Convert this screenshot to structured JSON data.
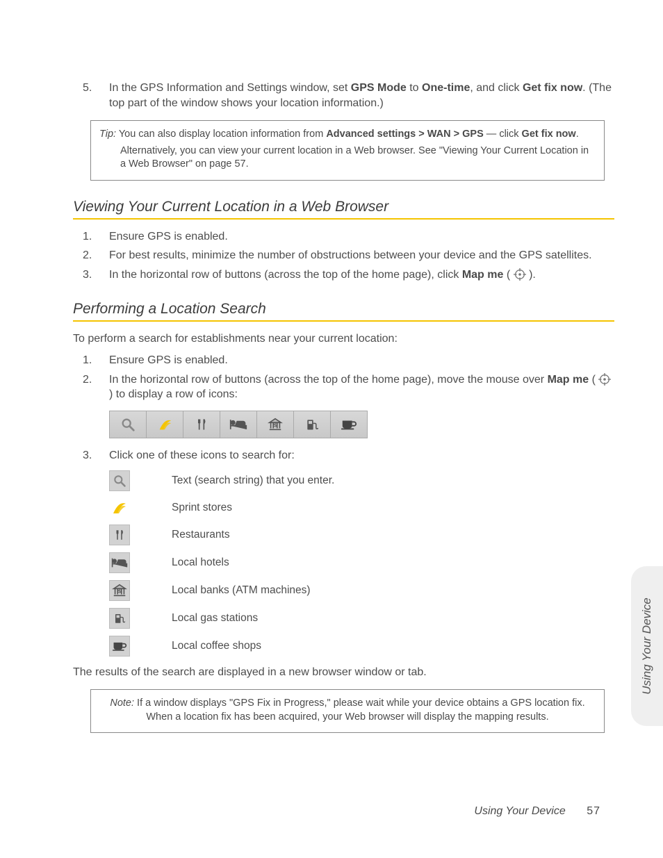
{
  "step5": {
    "num": "5.",
    "pre": "In the GPS Information and Settings window, set ",
    "b1": "GPS Mode",
    "mid1": " to ",
    "b2": "One-time",
    "mid2": ", and click ",
    "b3": "Get fix now",
    "post": ". (The top part of the window shows your location information.)"
  },
  "tip": {
    "label": "Tip:",
    "line1a": " You can also display location information from ",
    "b1": "Advanced settings",
    "gt1": " > ",
    "b2": "WAN",
    "gt2": " > ",
    "b3": "GPS",
    "dash": " — click ",
    "b4": "Get fix now",
    "end1": ".",
    "line2": "Alternatively, you can view your current location in a Web browser. See \"Viewing Your Current Location in a Web Browser\" on page 57."
  },
  "sectionA": "Viewing Your Current Location in a Web Browser",
  "a1": {
    "num": "1.",
    "txt": "Ensure GPS is enabled."
  },
  "a2": {
    "num": "2.",
    "txt": "For best results, minimize the number of obstructions between your device and the GPS satellites."
  },
  "a3": {
    "num": "3.",
    "pre": "In the horizontal row of buttons (across the top of the home page), click ",
    "b1": "Map me",
    "post": " ( ",
    "post2": " )."
  },
  "sectionB": "Performing a Location Search",
  "bIntro": "To perform a search for establishments near your current location:",
  "b1": {
    "num": "1.",
    "txt": "Ensure GPS is enabled."
  },
  "b2": {
    "num": "2.",
    "pre": "In the horizontal row of buttons (across the top of the home page), move the mouse over ",
    "bold": "Map me",
    "post": " ( ",
    "post2": " ) to display a row of icons:"
  },
  "b3": {
    "num": "3.",
    "txt": "Click one of these icons to search for:"
  },
  "iconTable": {
    "search": "Text (search string) that you enter.",
    "sprint": "Sprint stores",
    "restaurant": "Restaurants",
    "hotel": "Local hotels",
    "bank": "Local banks (ATM machines)",
    "gas": "Local gas stations",
    "coffee": "Local coffee shops"
  },
  "bResults": "The results of the search are displayed in a new browser window or tab.",
  "note": {
    "label": "Note:",
    "txt": "  If a window displays \"GPS Fix in Progress,\" please wait while your device obtains a GPS location fix. When a location fix has been acquired, your Web browser will display the mapping results."
  },
  "footer": {
    "title": "Using Your Device",
    "page": "57"
  },
  "sidetab": "Using Your Device"
}
